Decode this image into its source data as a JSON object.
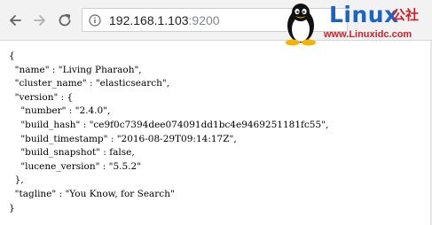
{
  "browser": {
    "address_bar": {
      "host": "192.168.1.103",
      "port": ":9200"
    }
  },
  "watermark": {
    "brand": "Linux",
    "brand_cn": "公社",
    "site": "www.Linuxidc.com"
  },
  "response_lines": [
    "{",
    "  \"name\" : \"Living Pharaoh\",",
    "  \"cluster_name\" : \"elasticsearch\",",
    "  \"version\" : {",
    "    \"number\" : \"2.4.0\",",
    "    \"build_hash\" : \"ce9f0c7394dee074091dd1bc4e9469251181fc55\",",
    "    \"build_timestamp\" : \"2016-08-29T09:14:17Z\",",
    "    \"build_snapshot\" : false,",
    "    \"lucene_version\" : \"5.5.2\"",
    "  },",
    "  \"tagline\" : \"You Know, for Search\"",
    "}"
  ],
  "colors": {
    "toolbar_bg": "#f2f2f2",
    "watermark_blue": "#1b63c6",
    "watermark_red": "#d0202a"
  },
  "icons": [
    "back-arrow-icon",
    "forward-arrow-icon",
    "reload-icon",
    "info-icon",
    "tux-penguin-icon"
  ]
}
